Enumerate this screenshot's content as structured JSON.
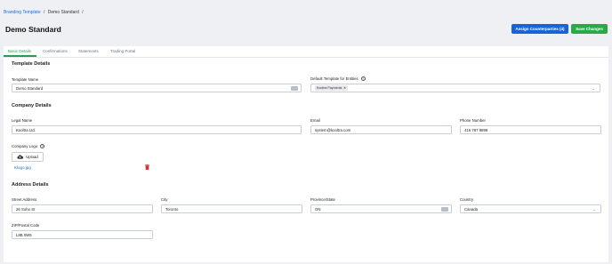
{
  "breadcrumb": {
    "link": "Branding Template",
    "separator": "/",
    "current": "Demo Standard",
    "trailing_separator": "/"
  },
  "page": {
    "title": "Demo Standard"
  },
  "actions": {
    "assign_label": "Assign Counterparties (4)",
    "save_label": "Save Changes"
  },
  "colors": {
    "primary": "#1565d8",
    "success": "#2ba84a",
    "active_tab": "#2a9a4b",
    "link": "#1b6fd1",
    "danger": "#d9342b"
  },
  "tabs": [
    {
      "label": "Basic Details",
      "active": true
    },
    {
      "label": "Confirmations",
      "active": false
    },
    {
      "label": "Statements",
      "active": false
    },
    {
      "label": "Trading Portal",
      "active": false
    }
  ],
  "template_details": {
    "heading": "Template Details",
    "template_name_label": "Template Name",
    "template_name_value": "Demo Standard",
    "default_entities_label": "Default Template for Entities",
    "entity_chip": "Kooltra Payments"
  },
  "company_details": {
    "heading": "Company Details",
    "legal_name_label": "Legal Name",
    "legal_name_value": "Kooltra Ltd.",
    "email_label": "Email",
    "email_value": "system@kooltra.com",
    "phone_label": "Phone Number",
    "phone_value": "416 787 9899",
    "logo_label": "Company Logo",
    "upload_label": "Upload",
    "logo_file": "Klogo.jpg"
  },
  "address_details": {
    "heading": "Address Details",
    "street_label": "Street Address",
    "street_value": "26 Soho St",
    "city_label": "City",
    "city_value": "Toronto",
    "province_label": "Province/State",
    "province_value": "ON",
    "country_label": "Country",
    "country_value": "Canada",
    "zip_label": "ZIP/Postal Code",
    "zip_value": "L8B 0W5"
  },
  "icons": [
    "help-icon",
    "close-icon",
    "chevron-down-icon",
    "cloud-upload-icon",
    "trash-icon"
  ]
}
